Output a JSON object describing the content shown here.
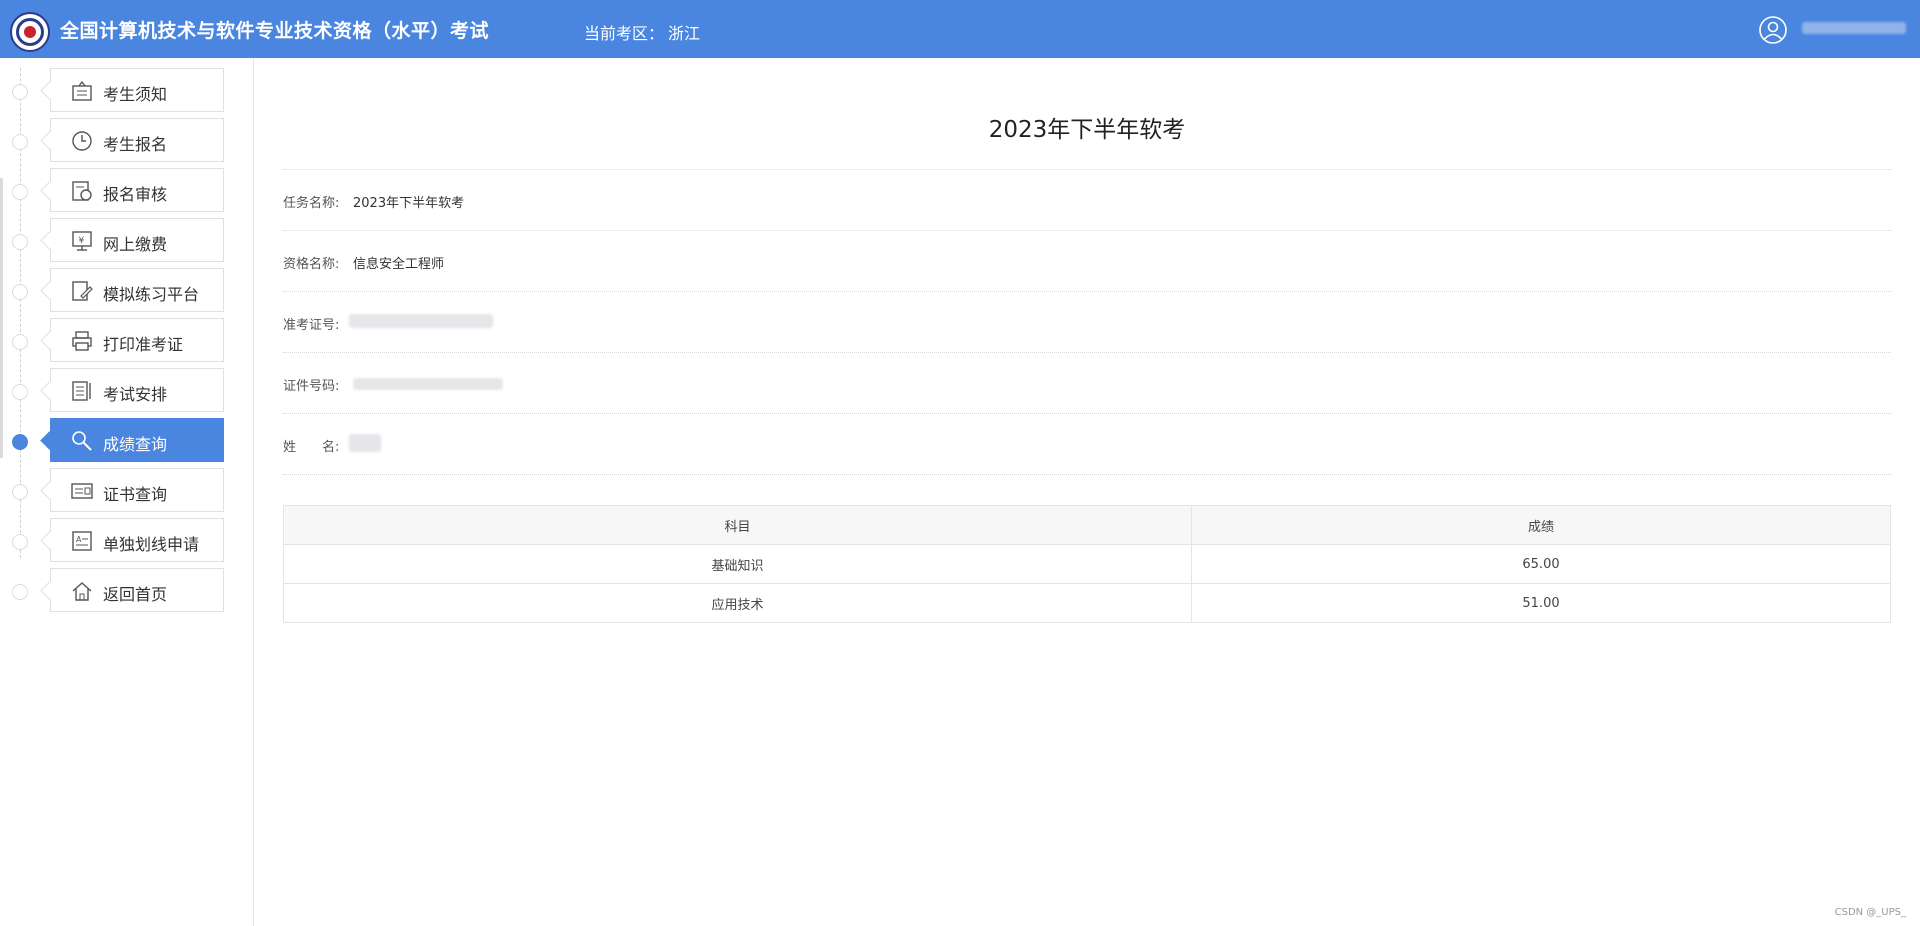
{
  "header": {
    "title": "全国计算机技术与软件专业技术资格（水平）考试",
    "region_label": "当前考区：",
    "region_value": "浙江",
    "brand_color": "#4a86e0"
  },
  "sidebar": {
    "items": [
      {
        "label": "考生须知",
        "icon": "notice-board-icon"
      },
      {
        "label": "考生报名",
        "icon": "clock-icon"
      },
      {
        "label": "报名审核",
        "icon": "review-document-icon"
      },
      {
        "label": "网上缴费",
        "icon": "payment-monitor-icon"
      },
      {
        "label": "模拟练习平台",
        "icon": "edit-document-icon"
      },
      {
        "label": "打印准考证",
        "icon": "printer-icon"
      },
      {
        "label": "考试安排",
        "icon": "schedule-document-icon"
      },
      {
        "label": "成绩查询",
        "icon": "search-magnifier-icon",
        "active": true
      },
      {
        "label": "证书查询",
        "icon": "certificate-icon"
      },
      {
        "label": "单独划线申请",
        "icon": "application-form-icon"
      },
      {
        "label": "返回首页",
        "icon": "home-icon"
      }
    ]
  },
  "main": {
    "title": "2023年下半年软考",
    "fields": [
      {
        "label": "任务名称:",
        "value": "2023年下半年软考"
      },
      {
        "label": "资格名称:",
        "value": "信息安全工程师"
      },
      {
        "label": "准考证号:",
        "value": ""
      },
      {
        "label": "证件号码:",
        "value": ""
      },
      {
        "label": "姓　　名:",
        "value": ""
      }
    ],
    "table": {
      "headers": [
        "科目",
        "成绩"
      ],
      "rows": [
        [
          "基础知识",
          "65.00"
        ],
        [
          "应用技术",
          "51.00"
        ]
      ]
    }
  },
  "watermark": "CSDN @_UPS_"
}
